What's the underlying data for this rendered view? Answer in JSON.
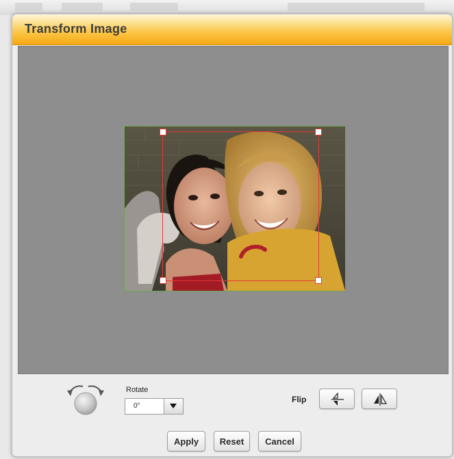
{
  "dialog": {
    "title": "Transform Image"
  },
  "rotate": {
    "label": "Rotate",
    "value": "0°"
  },
  "flip": {
    "label": "Flip",
    "vertical_icon": "flip-vertical-icon",
    "horizontal_icon": "flip-horizontal-icon"
  },
  "actions": {
    "apply_label": "Apply",
    "reset_label": "Reset",
    "cancel_label": "Cancel"
  },
  "colors": {
    "title_gradient_top": "#fff6da",
    "title_gradient_bottom": "#f6a915",
    "canvas_bg": "#8e8e8e",
    "crop_border": "#e53935",
    "image_border": "#6aa84f"
  }
}
